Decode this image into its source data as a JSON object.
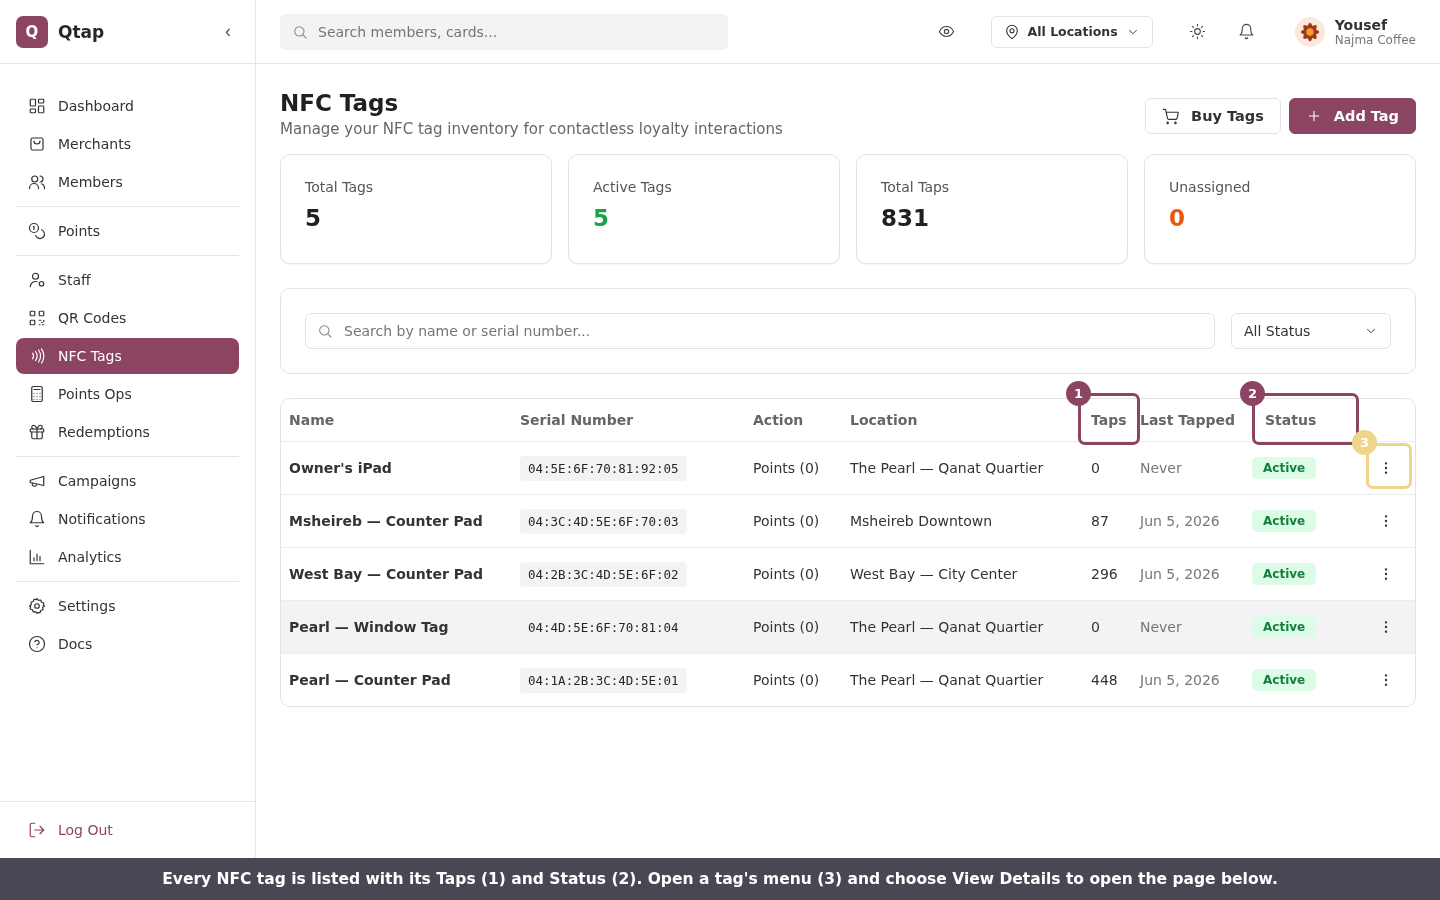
{
  "brand": {
    "logo": "Q",
    "name": "Qtap",
    "collapse": "‹"
  },
  "sidebar": {
    "groups": [
      [
        {
          "label": "Dashboard",
          "selected": false
        },
        {
          "label": "Merchants",
          "selected": false
        },
        {
          "label": "Members",
          "selected": false
        }
      ],
      [
        {
          "label": "Points",
          "selected": false
        }
      ],
      [
        {
          "label": "Staff",
          "selected": false
        },
        {
          "label": "QR Codes",
          "selected": false
        },
        {
          "label": "NFC Tags",
          "selected": true
        },
        {
          "label": "Points Ops",
          "selected": false
        },
        {
          "label": "Redemptions",
          "selected": false
        }
      ],
      [
        {
          "label": "Campaigns",
          "selected": false
        },
        {
          "label": "Notifications",
          "selected": false
        },
        {
          "label": "Analytics",
          "selected": false
        }
      ],
      [
        {
          "label": "Settings",
          "selected": false
        },
        {
          "label": "Docs",
          "selected": false
        }
      ]
    ],
    "logout": "Log Out"
  },
  "topbar": {
    "search": {
      "placeholder": "Search members, cards..."
    },
    "location": "All Locations",
    "user": {
      "name": "Yousef",
      "business": "Najma Coffee"
    }
  },
  "page": {
    "title": "NFC Tags",
    "subtitle": "Manage your NFC tag inventory for contactless loyalty interactions",
    "buttons": [
      {
        "label": "Buy Tags",
        "kind": "secondary"
      },
      {
        "label": "Add Tag",
        "kind": "primary"
      }
    ]
  },
  "stats": [
    {
      "label": "Total Tags",
      "value": "5",
      "color": "#1f1f24"
    },
    {
      "label": "Active Tags",
      "value": "5",
      "color": "#16a34a"
    },
    {
      "label": "Total Taps",
      "value": "831",
      "color": "#1f1f24"
    },
    {
      "label": "Unassigned",
      "value": "0",
      "color": "#ea580c"
    }
  ],
  "filters": {
    "search": {
      "placeholder": "Search by name or serial number..."
    },
    "status": "All Status"
  },
  "table": {
    "columns": [
      {
        "label": "Name"
      },
      {
        "label": "Serial Number"
      },
      {
        "label": "Action"
      },
      {
        "label": "Location"
      },
      {
        "label": "Taps",
        "callout": {
          "label": "1",
          "color": "#8b4563"
        }
      },
      {
        "label": "Last Tapped"
      },
      {
        "label": "Status",
        "callout": {
          "label": "2",
          "color": "#8b4563"
        }
      }
    ],
    "rows": [
      {
        "name": "Owner's iPad",
        "serial": "04:5E:6F:70:81:92:05",
        "action": "Points (0)",
        "location": "The Pearl — Qanat Quartier",
        "taps": "0",
        "last_tapped": "Never",
        "status": "Active",
        "hovered": false,
        "menu_callout": {
          "label": "3",
          "color": "#f0d48a"
        }
      },
      {
        "name": "Msheireb — Counter Pad",
        "serial": "04:3C:4D:5E:6F:70:03",
        "action": "Points (0)",
        "location": "Msheireb Downtown",
        "taps": "87",
        "last_tapped": "Jun 5, 2026",
        "status": "Active",
        "hovered": false
      },
      {
        "name": "West Bay — Counter Pad",
        "serial": "04:2B:3C:4D:5E:6F:02",
        "action": "Points (0)",
        "location": "West Bay — City Center",
        "taps": "296",
        "last_tapped": "Jun 5, 2026",
        "status": "Active",
        "hovered": false
      },
      {
        "name": "Pearl — Window Tag",
        "serial": "04:4D:5E:6F:70:81:04",
        "action": "Points (0)",
        "location": "The Pearl — Qanat Quartier",
        "taps": "0",
        "last_tapped": "Never",
        "status": "Active",
        "hovered": true
      },
      {
        "name": "Pearl — Counter Pad",
        "serial": "04:1A:2B:3C:4D:5E:01",
        "action": "Points (0)",
        "location": "The Pearl — Qanat Quartier",
        "taps": "448",
        "last_tapped": "Jun 5, 2026",
        "status": "Active",
        "hovered": false
      }
    ]
  },
  "caption": "Every NFC tag is listed with its Taps (1) and Status (2). Open a tag's menu (3) and choose View Details to open the page below."
}
